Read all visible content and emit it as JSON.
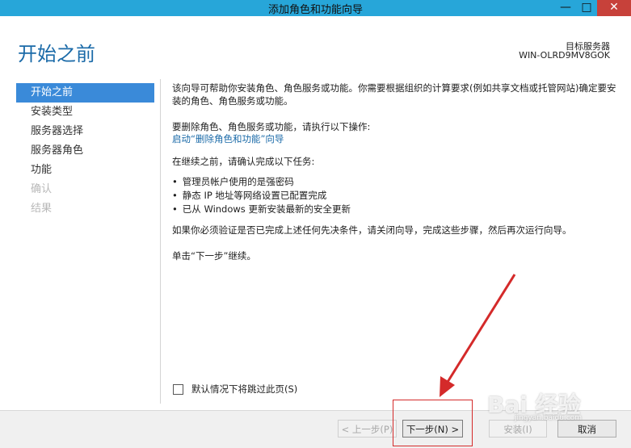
{
  "window": {
    "title": "添加角色和功能向导",
    "minimize_label": "—",
    "maximize_label": "□",
    "close_label": "✕"
  },
  "header": {
    "page_title": "开始之前",
    "server_label": "目标服务器",
    "server_name": "WIN-OLRD9MV8GOK"
  },
  "nav": {
    "items": [
      {
        "label": "开始之前",
        "state": "active"
      },
      {
        "label": "安装类型",
        "state": "normal"
      },
      {
        "label": "服务器选择",
        "state": "normal"
      },
      {
        "label": "服务器角色",
        "state": "normal"
      },
      {
        "label": "功能",
        "state": "normal"
      },
      {
        "label": "确认",
        "state": "disabled"
      },
      {
        "label": "结果",
        "state": "disabled"
      }
    ]
  },
  "content": {
    "intro": "该向导可帮助你安装角色、角色服务或功能。你需要根据组织的计算要求(例如共享文档或托管网站)确定要安装的角色、角色服务或功能。",
    "remove_instruction": "要删除角色、角色服务或功能，请执行以下操作:",
    "remove_link": "启动“删除角色和功能”向导",
    "before_continue": "在继续之前，请确认完成以下任务:",
    "tasks": [
      "管理员帐户使用的是强密码",
      "静态 IP 地址等网络设置已配置完成",
      "已从 Windows 更新安装最新的安全更新"
    ],
    "prereq_note": "如果你必须验证是否已完成上述任何先决条件，请关闭向导，完成这些步骤，然后再次运行向导。",
    "click_next": "单击“下一步”继续。"
  },
  "skip_checkbox": {
    "label": "默认情况下将跳过此页(S)",
    "checked": false
  },
  "footer": {
    "prev_label": "< 上一步(P)",
    "next_label": "下一步(N) >",
    "install_label": "安装(I)",
    "cancel_label": "取消"
  },
  "watermark": {
    "text": "Bai 经验",
    "sub": "jingyan.baidu.com"
  },
  "colors": {
    "titlebar": "#27a6d9",
    "accent": "#1a6aa8",
    "nav_active": "#3a8ad9",
    "annotation_red": "#d42a2a"
  }
}
